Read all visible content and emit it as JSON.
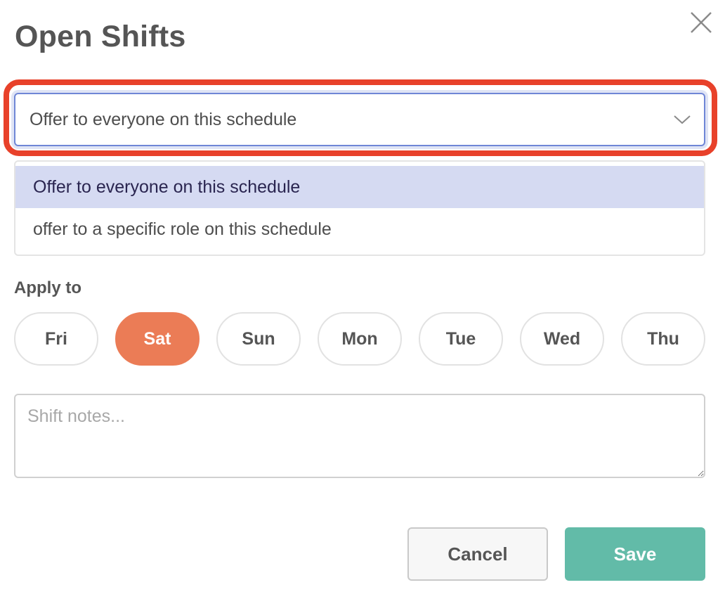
{
  "dialog": {
    "title": "Open Shifts",
    "close_icon": "close-icon"
  },
  "offer_select": {
    "value": "Offer to everyone on this schedule",
    "chevron_icon": "chevron-down-icon",
    "expanded": true,
    "options": [
      {
        "label": "Offer to everyone on this schedule",
        "selected": true
      },
      {
        "label": "offer to a specific role on this schedule",
        "selected": false
      }
    ],
    "highlight_color": "#e8412a"
  },
  "apply_to": {
    "label": "Apply to",
    "days": [
      {
        "label": "Fri",
        "active": false
      },
      {
        "label": "Sat",
        "active": true
      },
      {
        "label": "Sun",
        "active": false
      },
      {
        "label": "Mon",
        "active": false
      },
      {
        "label": "Tue",
        "active": false
      },
      {
        "label": "Wed",
        "active": false
      },
      {
        "label": "Thu",
        "active": false
      }
    ],
    "active_color": "#eb7c56"
  },
  "notes": {
    "value": "",
    "placeholder": "Shift notes..."
  },
  "footer": {
    "cancel_label": "Cancel",
    "save_label": "Save",
    "save_color": "#62bba8"
  }
}
